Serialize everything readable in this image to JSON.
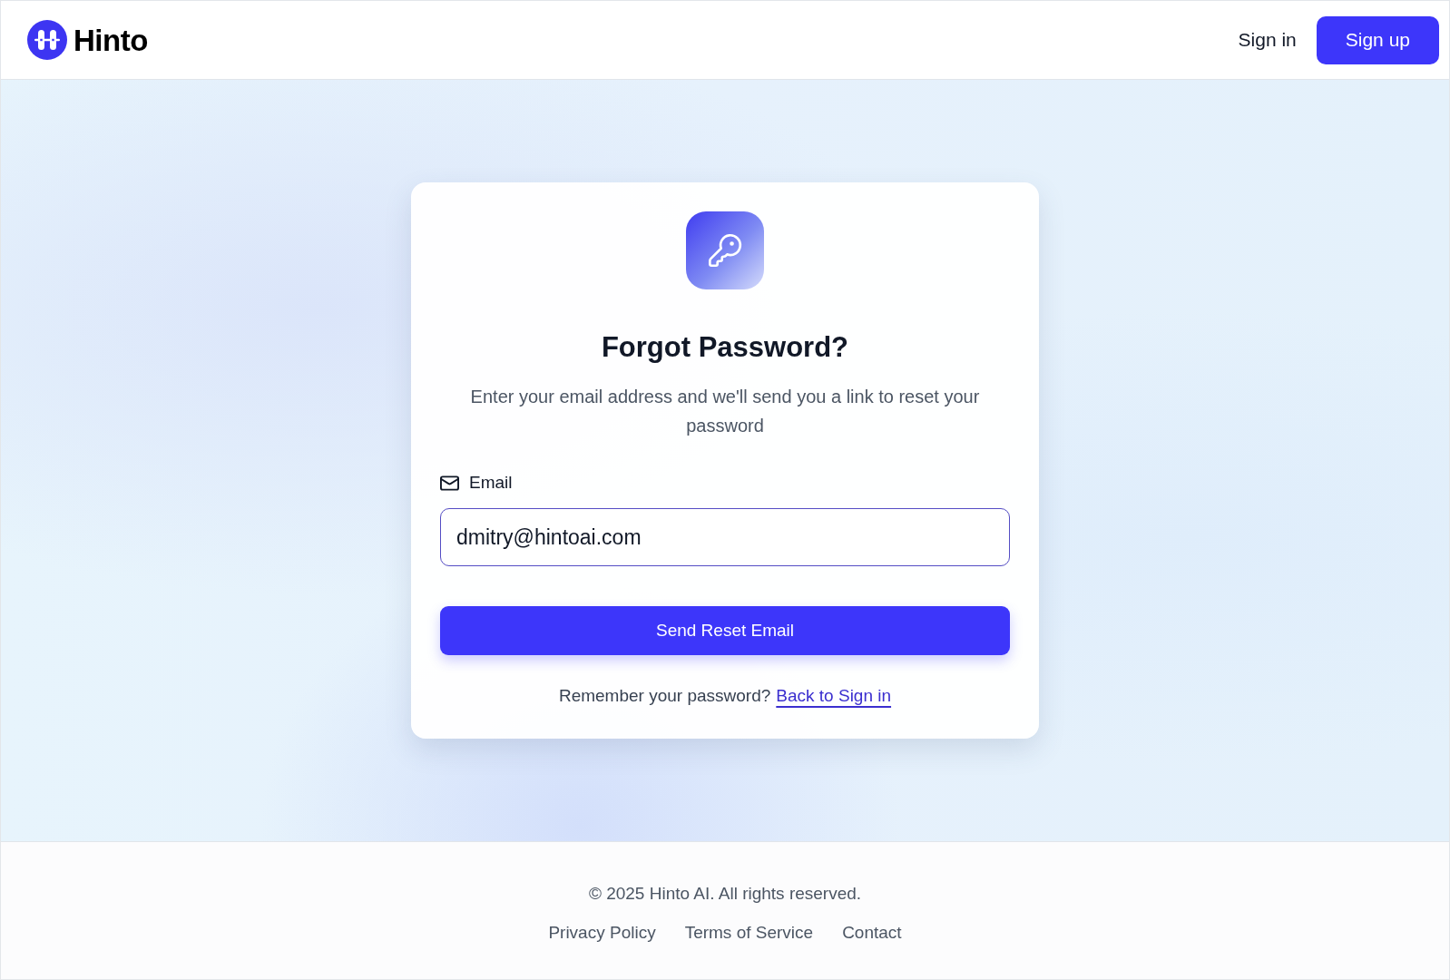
{
  "header": {
    "logo": {
      "text": "Hinto"
    },
    "nav": [
      {
        "label": "Sign in",
        "kind": "link"
      },
      {
        "label": "Sign up",
        "kind": "button"
      }
    ]
  },
  "card": {
    "title": "Forgot Password?",
    "description": "Enter your email address and we'll send you a link to reset your password",
    "email_field": {
      "label": "Email",
      "value": "dmitry@hintoai.com"
    },
    "submit_button": "Send Reset Email",
    "prompt": {
      "text": "Remember your password?",
      "link": "Back to Sign in"
    }
  },
  "footer": {
    "copyright": "© 2025 Hinto AI. All rights reserved.",
    "links": [
      "Privacy Policy",
      "Terms of Service",
      "Contact"
    ]
  }
}
